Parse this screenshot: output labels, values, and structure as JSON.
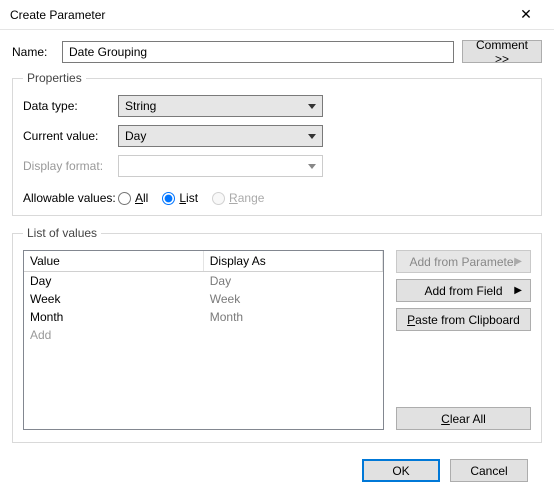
{
  "window": {
    "title": "Create Parameter"
  },
  "name": {
    "label": "Name:",
    "value": "Date Grouping"
  },
  "comment_btn": "Comment >>",
  "properties": {
    "legend": "Properties",
    "data_type_label": "Data type:",
    "data_type_value": "String",
    "current_value_label": "Current value:",
    "current_value_value": "Day",
    "display_format_label": "Display format:",
    "display_format_value": "",
    "allowable_label": "Allowable values:",
    "allowable": {
      "all": "All",
      "list": "List",
      "range": "Range",
      "selected": "list"
    }
  },
  "lov": {
    "legend": "List of values",
    "headers": {
      "value": "Value",
      "display": "Display As"
    },
    "rows": [
      {
        "value": "Day",
        "display": "Day"
      },
      {
        "value": "Week",
        "display": "Week"
      },
      {
        "value": "Month",
        "display": "Month"
      }
    ],
    "add_placeholder": "Add",
    "buttons": {
      "add_from_parameter": "Add from Parameter",
      "add_from_field": "Add from Field",
      "paste_from_clipboard": "Paste from Clipboard",
      "clear_all": "Clear All"
    }
  },
  "footer": {
    "ok": "OK",
    "cancel": "Cancel"
  }
}
